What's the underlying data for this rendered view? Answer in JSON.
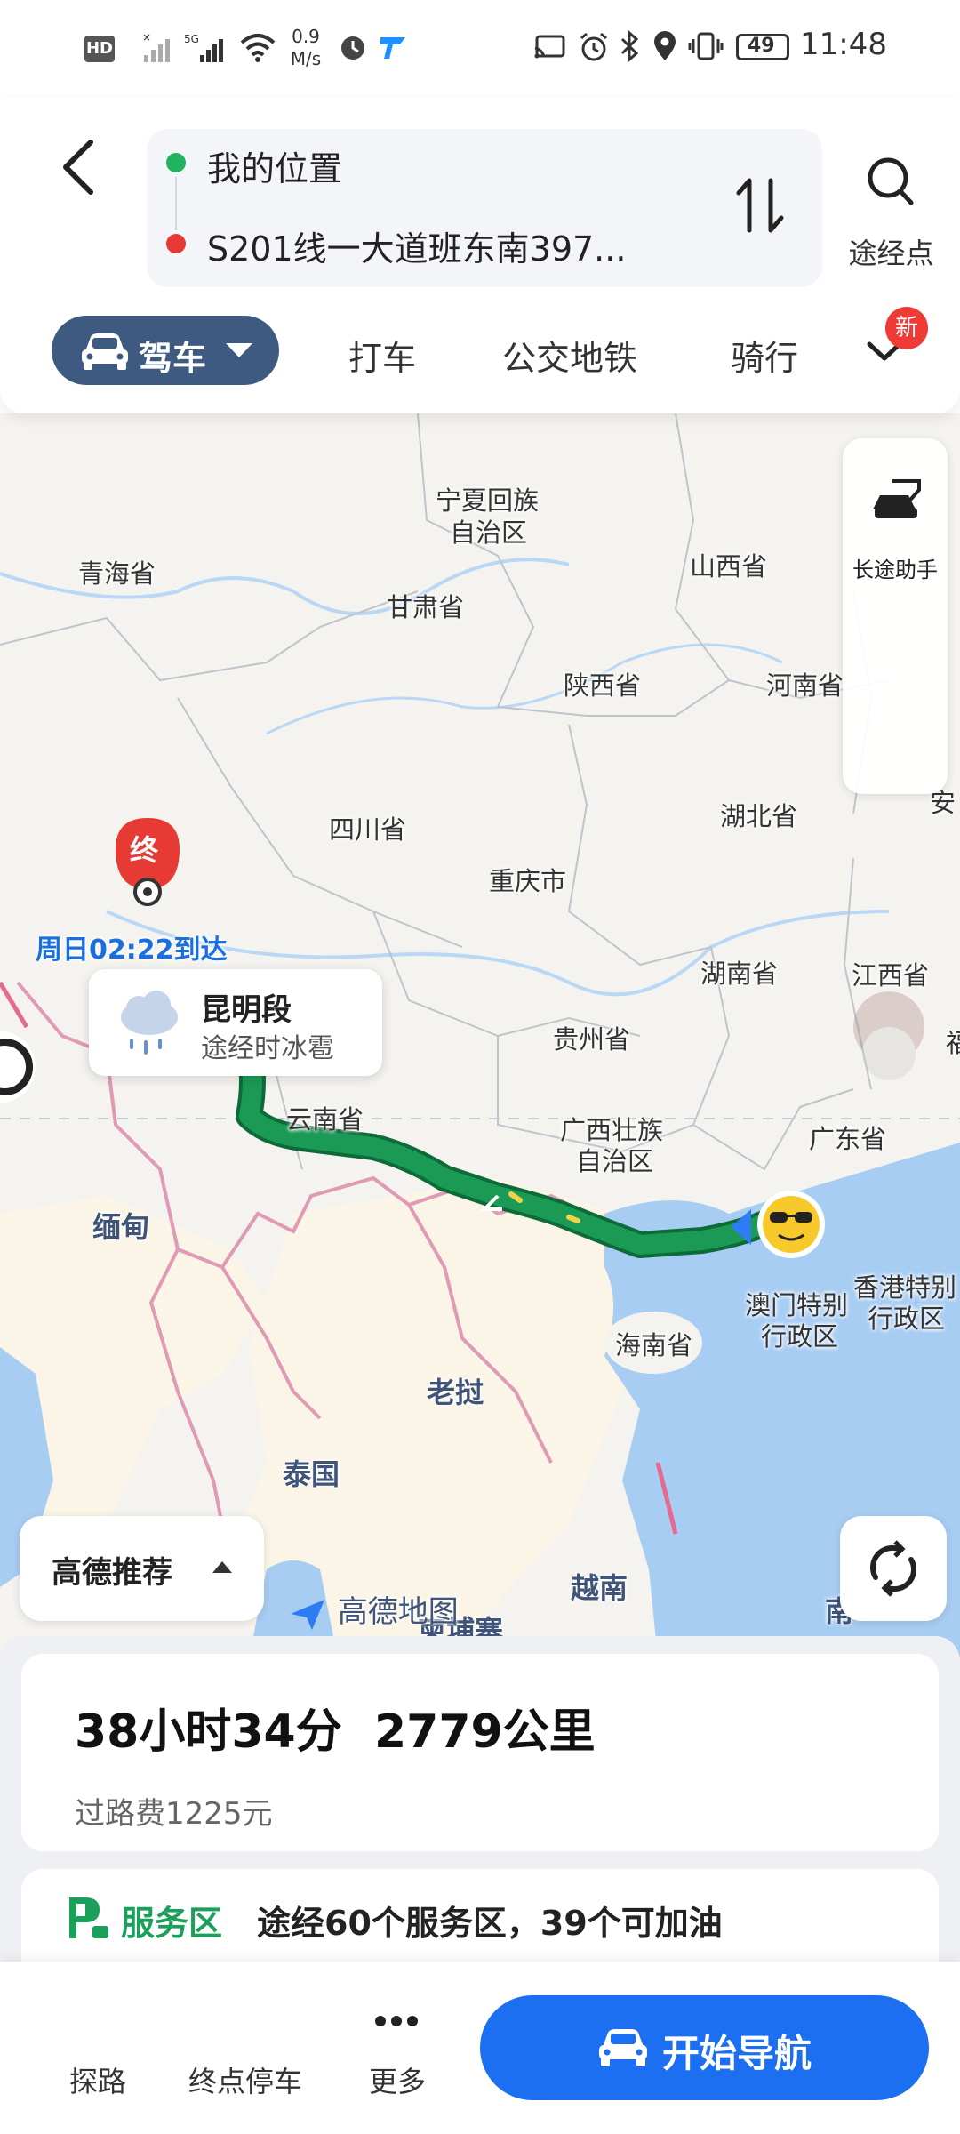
{
  "status_bar": {
    "left_icons": [
      "hd-icon",
      "no-signal-icon",
      "5g-signal-icon",
      "wifi-icon",
      "alarm-icon",
      "app-icon"
    ],
    "speed_value": "0.9",
    "speed_unit": "M/s",
    "battery": "49",
    "time": "11:48"
  },
  "header": {
    "origin": "我的位置",
    "destination": "S201线一大道班东南397...",
    "waypoint_label": "途经点",
    "colors": {
      "origin_dot": "#22b35e",
      "destination_dot": "#e83a35",
      "active_tab": "#3f5a80"
    }
  },
  "modes": {
    "active": "驾车",
    "tabs": [
      "打车",
      "公交地铁",
      "骑行"
    ],
    "new_badge": "新"
  },
  "map": {
    "side_tool_label": "长途助手",
    "destination_marker": "终",
    "eta": "周日02:22到达",
    "weather_title": "昆明段",
    "weather_desc": "途经时冰雹",
    "recommend_label": "高德推荐",
    "logo": "高德地图",
    "provinces": {
      "qinghai": "青海省",
      "ningxia_1": "宁夏回族",
      "ningxia_2": "自治区",
      "shanxi": "山西省",
      "gansu": "甘肃省",
      "shaanxi": "陕西省",
      "henan": "河南省",
      "sichuan": "四川省",
      "hubei": "湖北省",
      "chongqing": "重庆市",
      "hunan": "湖南省",
      "jiangxi": "江西省",
      "guizhou": "贵州省",
      "yunnan": "云南省",
      "guangxi_1": "广西壮族",
      "guangxi_2": "自治区",
      "guangdong": "广东省",
      "macau_1": "澳门特别",
      "macau_2": "行政区",
      "hongkong_1": "香港特别",
      "hongkong_2": "行政区",
      "hainan": "海南省",
      "anhui_partial": "安",
      "fujian_partial": "福"
    },
    "countries": {
      "myanmar": "缅甸",
      "laos": "老挝",
      "thailand": "泰国",
      "vietnam": "越南",
      "cambodia": "柬埔寨",
      "south_partial": "南"
    },
    "colors": {
      "route": "#1a9a55",
      "route_outline": "#0d6b3a",
      "sea": "#a8cdf3",
      "eta_text": "#1a6fe0"
    }
  },
  "summary": {
    "duration": "38小时34分",
    "distance": "2779公里",
    "toll": "过路费1225元"
  },
  "service": {
    "title": "服务区",
    "desc": "途经60个服务区，39个可加油"
  },
  "bottom_bar": {
    "explore": "探路",
    "parking": "终点停车",
    "more": "更多",
    "start": "开始导航"
  }
}
